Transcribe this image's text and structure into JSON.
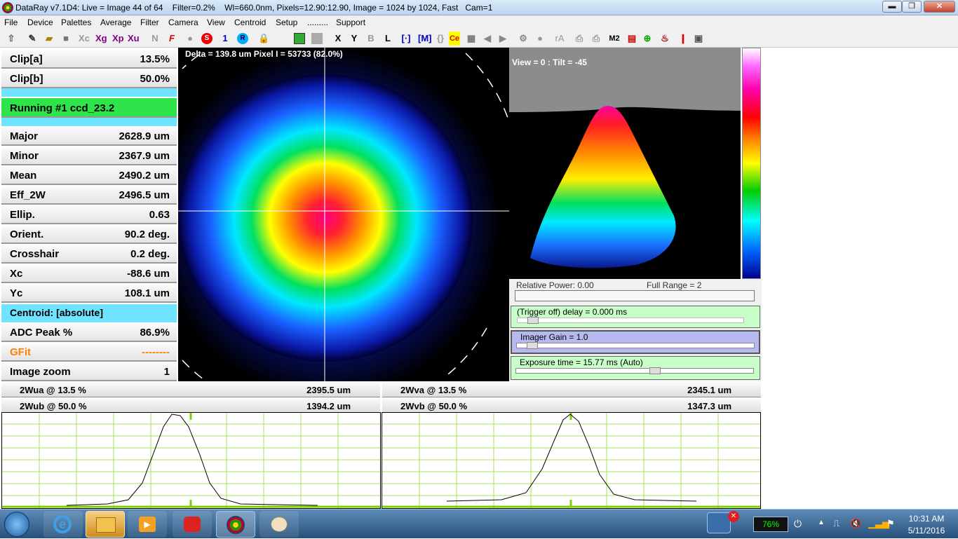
{
  "window": {
    "title": "DataRay v7.1D4: Live = Image 44 of 64    Filter=0.2%    Wl=660.0nm, Pixels=12.90:12.90, Image = 1024 by 1024, Fast   Cam=1",
    "min_glyph": "▬",
    "max_glyph": "❐",
    "close_glyph": "✕"
  },
  "menu": [
    "File",
    "Device",
    "Palettes",
    "Average",
    "Filter",
    "Camera",
    "View",
    "Centroid",
    "Setup",
    ".........",
    "Support"
  ],
  "toolbar": {
    "xc": "Xc",
    "xg": "Xg",
    "xp": "Xp",
    "xu": "Xu",
    "n": "N",
    "f": "F",
    "s": "S",
    "one": "1",
    "r": "R",
    "x": "X",
    "y": "Y",
    "b": "B",
    "l": "L",
    "ce": "Ce",
    "ra": "rA",
    "m2": "M2"
  },
  "left": {
    "clip_a_label": "Clip[a]",
    "clip_a_value": "13.5%",
    "clip_b_label": "Clip[b]",
    "clip_b_value": "50.0%",
    "running": "Running #1 ccd_23.2",
    "major_label": "Major",
    "major_value": "2628.9 um",
    "minor_label": "Minor",
    "minor_value": "2367.9 um",
    "mean_label": "Mean",
    "mean_value": "2490.2 um",
    "eff_label": "Eff_2W",
    "eff_value": "2496.5 um",
    "ellip_label": "Ellip.",
    "ellip_value": "0.63",
    "orient_label": "Orient.",
    "orient_value": "90.2 deg.",
    "cross_label": "Crosshair",
    "cross_value": "0.2 deg.",
    "xc_label": "Xc",
    "xc_value": "-88.6 um",
    "yc_label": "Yc",
    "yc_value": "108.1 um",
    "centroid": "Centroid: [absolute]",
    "adc_label": "ADC Peak %",
    "adc_value": "86.9%",
    "gfit_label": "GFit",
    "gfit_value": "--------",
    "zoom_label": "Image zoom",
    "zoom_value": "1"
  },
  "beam": {
    "readout": "Delta = 139.8 um Pixel I = 53733 (82.0%)"
  },
  "view3d": {
    "label": "View = 0 : Tilt = -45"
  },
  "controls": {
    "relative_power": "Relative Power: 0.00",
    "full_range": "Full Range = 2",
    "trigger": "(Trigger off) delay = 0.000 ms",
    "gain": "Imager Gain = 1.0",
    "exposure": "Exposure time = 15.77 ms (Auto)"
  },
  "profiles": {
    "wua_label": "2Wua @ 13.5 %",
    "wua_value": "2395.5 um",
    "wub_label": "2Wub @ 50.0 %",
    "wub_value": "1394.2 um",
    "wva_label": "2Wva @ 13.5 %",
    "wva_value": "2345.1 um",
    "wvb_label": "2Wvb @ 50.0 %",
    "wvb_value": "1347.3 um"
  },
  "taskbar": {
    "battery": "76%",
    "time": "10:31 AM",
    "date": "5/11/2016"
  }
}
